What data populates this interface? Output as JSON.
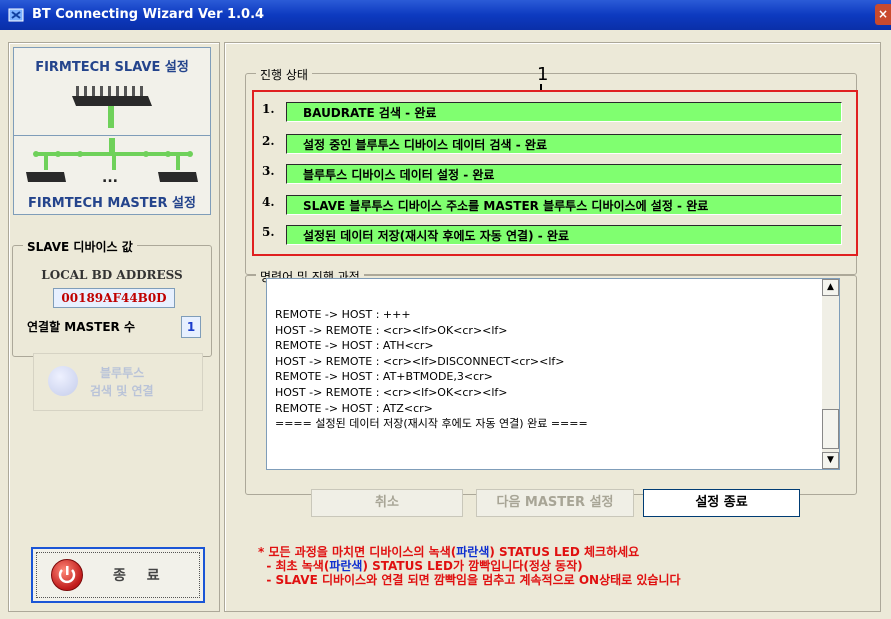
{
  "window": {
    "title": "BT Connecting Wizard Ver 1.0.4",
    "close_label": "×"
  },
  "left": {
    "slave_button_label": "FIRMTECH SLAVE 설정",
    "master_button_label": "FIRMTECH MASTER 설정",
    "master_dots": "...",
    "slave_group_label": "SLAVE 디바이스 값",
    "local_bd_label": "LOCAL BD ADDRESS",
    "local_bd_value": "00189AF44B0D",
    "master_count_label": "연결할 MASTER 수",
    "master_count_value": "1",
    "search_line1": "블루투스",
    "search_line2": "검색 및 연결",
    "exit_label": "종 료"
  },
  "progress": {
    "group_label": "진행 상태",
    "callout": "1",
    "steps": [
      {
        "num": "1.",
        "text": "BAUDRATE 검색 - 완료"
      },
      {
        "num": "2.",
        "text": "설정 중인 블루투스 디바이스 데이터 검색 - 완료"
      },
      {
        "num": "3.",
        "text": "블루투스 디바이스 데이터 설정 - 완료"
      },
      {
        "num": "4.",
        "text": "SLAVE 블루투스 디바이스 주소를 MASTER 블루투스 디바이스에 설정 - 완료"
      },
      {
        "num": "5.",
        "text": "설정된 데이터 저장(재시작 후에도 자동 연결) - 완료"
      }
    ]
  },
  "log": {
    "group_label": "명령어 및 진행 과정",
    "lines": [
      "REMOTE -> HOST : +++",
      "HOST -> REMOTE : <cr><lf>OK<cr><lf>",
      "REMOTE -> HOST : ATH<cr>",
      "HOST -> REMOTE : <cr><lf>DISCONNECT<cr><lf>",
      "REMOTE -> HOST : AT+BTMODE,3<cr>",
      "HOST -> REMOTE : <cr><lf>OK<cr><lf>",
      "REMOTE -> HOST : ATZ<cr>",
      "==== 설정된 데이터 저장(재시작 후에도 자동 연결) 완료 ===="
    ],
    "scroll_up": "▲",
    "scroll_down": "▼"
  },
  "buttons": {
    "cancel": "취소",
    "next_master": "다음 MASTER 설정",
    "finish": "설정 종료"
  },
  "notes": {
    "line1_a": "* 모든 과정을 마치면 디바이스의 녹색(",
    "line1_b": "파란색",
    "line1_c": ") STATUS LED 체크하세요",
    "line2_a": "  - 최초 녹색(",
    "line2_b": "파란색",
    "line2_c": ") STATUS LED가 깜빡입니다(정상 동작)",
    "line3": "  - SLAVE 디바이스와 연결 되면 깜빡임을 멈추고 계속적으로 ON상태로 있습니다"
  },
  "colors": {
    "step_bar": "#80ff70",
    "highlight_box": "#e02020",
    "notes": "#e01010",
    "notes_blue": "#1030d0"
  }
}
